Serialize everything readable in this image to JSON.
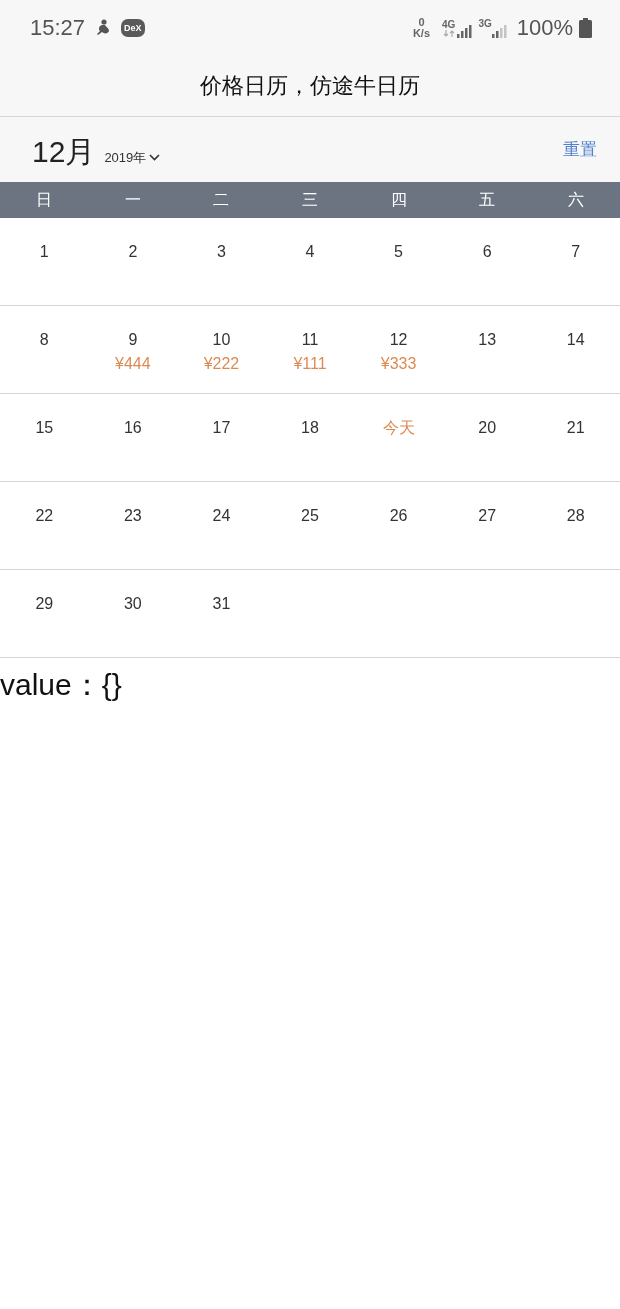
{
  "status_bar": {
    "time": "15:27",
    "badge": "DeX",
    "net_speed_value": "0",
    "net_speed_unit": "K/s",
    "network_1": "4G",
    "network_2": "3G",
    "battery": "100%"
  },
  "title": "价格日历，仿途牛日历",
  "header": {
    "month": "12月",
    "year": "2019年",
    "reset": "重置"
  },
  "weekdays": [
    "日",
    "一",
    "二",
    "三",
    "四",
    "五",
    "六"
  ],
  "weeks": [
    [
      {
        "label": "1",
        "today": false
      },
      {
        "label": "2",
        "today": false
      },
      {
        "label": "3",
        "today": false
      },
      {
        "label": "4",
        "today": false
      },
      {
        "label": "5",
        "today": false
      },
      {
        "label": "6",
        "today": false
      },
      {
        "label": "7",
        "today": false
      }
    ],
    [
      {
        "label": "8",
        "today": false
      },
      {
        "label": "9",
        "price": "¥444",
        "today": false
      },
      {
        "label": "10",
        "price": "¥222",
        "today": false
      },
      {
        "label": "11",
        "price": "¥111",
        "today": false
      },
      {
        "label": "12",
        "price": "¥333",
        "today": false
      },
      {
        "label": "13",
        "today": false
      },
      {
        "label": "14",
        "today": false
      }
    ],
    [
      {
        "label": "15",
        "today": false
      },
      {
        "label": "16",
        "today": false
      },
      {
        "label": "17",
        "today": false
      },
      {
        "label": "18",
        "today": false
      },
      {
        "label": "今天",
        "today": true
      },
      {
        "label": "20",
        "today": false
      },
      {
        "label": "21",
        "today": false
      }
    ],
    [
      {
        "label": "22",
        "today": false
      },
      {
        "label": "23",
        "today": false
      },
      {
        "label": "24",
        "today": false
      },
      {
        "label": "25",
        "today": false
      },
      {
        "label": "26",
        "today": false
      },
      {
        "label": "27",
        "today": false
      },
      {
        "label": "28",
        "today": false
      }
    ],
    [
      {
        "label": "29",
        "today": false
      },
      {
        "label": "30",
        "today": false
      },
      {
        "label": "31",
        "today": false
      }
    ]
  ],
  "output": "value：{}"
}
